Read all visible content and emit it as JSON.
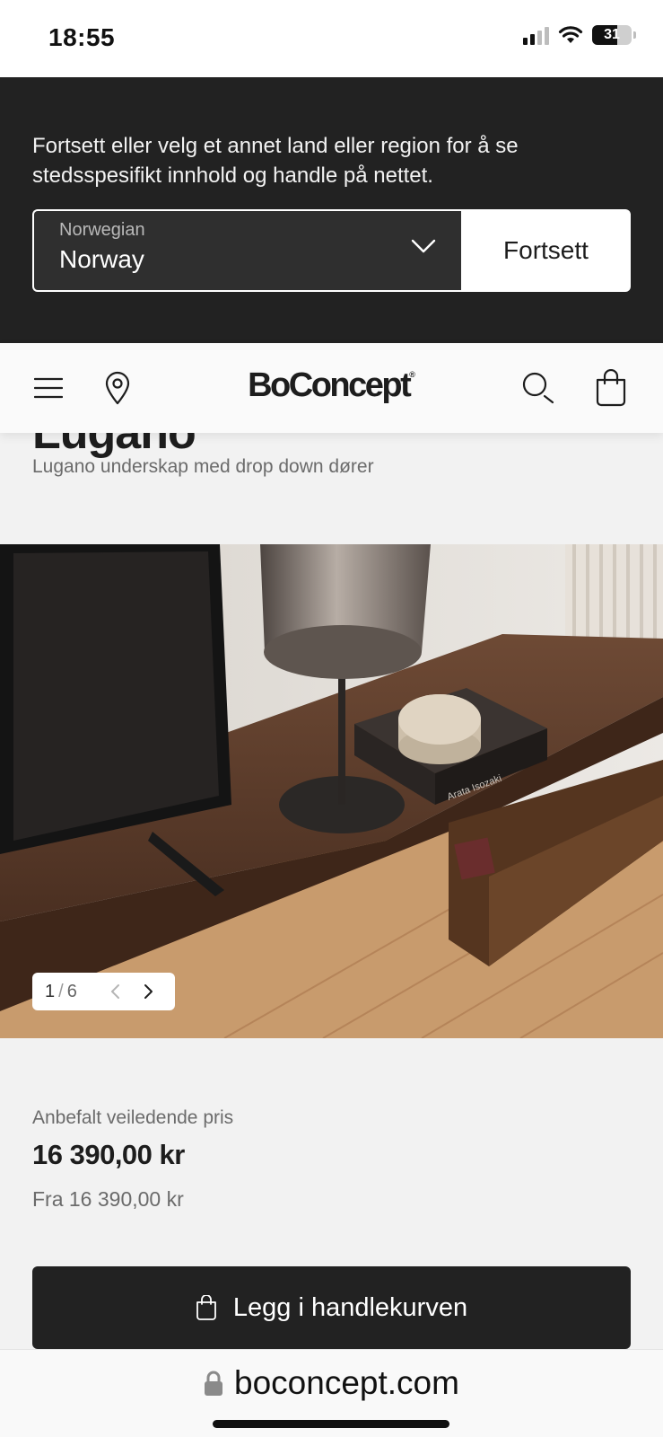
{
  "status_bar": {
    "time": "18:55",
    "battery": "31"
  },
  "region_banner": {
    "message": "Fortsett eller velg et annet land eller region for å se stedsspesifikt innhold og handle på nettet.",
    "selector_language": "Norwegian",
    "selector_country": "Norway",
    "continue_label": "Fortsett"
  },
  "header": {
    "logo": "BoConcept",
    "icons": [
      "menu-icon",
      "location-pin-icon",
      "search-icon",
      "shopping-bag-icon"
    ]
  },
  "product": {
    "title": "Lugano",
    "subtitle": "Lugano underskap med drop down dører"
  },
  "gallery": {
    "current": "1",
    "separator": "/",
    "total": "6"
  },
  "pricing": {
    "label": "Anbefalt veiledende pris",
    "price": "16 390,00 kr",
    "from": "Fra 16 390,00 kr"
  },
  "cart": {
    "add_label": "Legg i handlekurven"
  },
  "browser": {
    "url": "boconcept.com"
  },
  "colors": {
    "banner_bg": "#222222",
    "button_bg": "#222222",
    "page_bg": "#f2f2f2"
  }
}
